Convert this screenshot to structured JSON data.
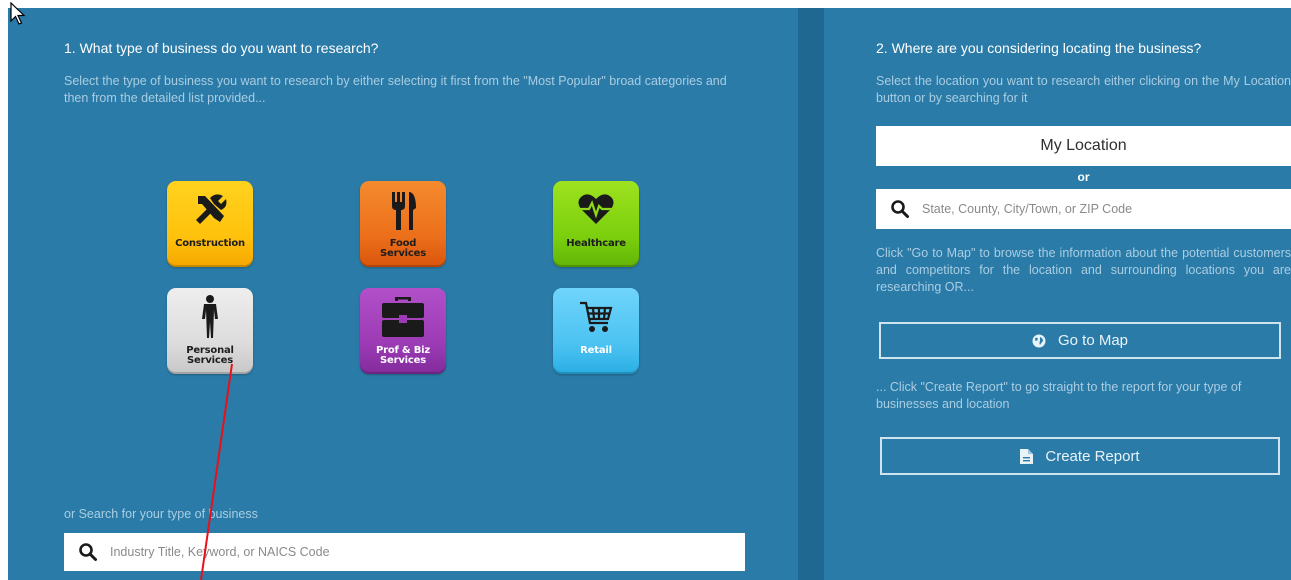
{
  "left_panel": {
    "heading": "1. What type of business do you want to research?",
    "description": "Select the type of business you want to research by either selecting it first from the \"Most Popular\" broad categories and then from the detailed list provided...",
    "categories": [
      {
        "label": "Construction",
        "icon": "tools-icon",
        "color": "#ffc20c"
      },
      {
        "label": "Food\nServices",
        "icon": "fork-knife-icon",
        "color": "#ec6f1a"
      },
      {
        "label": "Healthcare",
        "icon": "heart-pulse-icon",
        "color": "#7bcf0d"
      },
      {
        "label": "Personal\nServices",
        "icon": "person-icon",
        "color": "#dcdcdc"
      },
      {
        "label": "Prof & Biz\nServices",
        "icon": "briefcase-icon",
        "color": "#9c3bb5"
      },
      {
        "label": "Retail",
        "icon": "cart-icon",
        "color": "#4cc3f2"
      }
    ],
    "search_label": "or Search for your type of business",
    "search_placeholder": "Industry Title, Keyword, or NAICS Code"
  },
  "right_panel": {
    "heading": "2. Where are you considering locating the business?",
    "description": "Select the location you want to research either clicking on the My Location button or by searching for it",
    "my_location_label": "My Location",
    "or_label": "or",
    "location_placeholder": "State, County, City/Town, or ZIP Code",
    "go_to_map_description": "Click \"Go to Map\" to browse the information about the potential customers and competitors for the location and surrounding locations you are researching OR...",
    "go_to_map_label": "Go to Map",
    "create_report_description": "... Click \"Create Report\" to go straight to the report for your type of businesses and location",
    "create_report_label": "Create Report"
  },
  "colors": {
    "panel_background": "#2b7ba8",
    "divider": "#1f6891",
    "annotation_line": "#e8101a"
  }
}
